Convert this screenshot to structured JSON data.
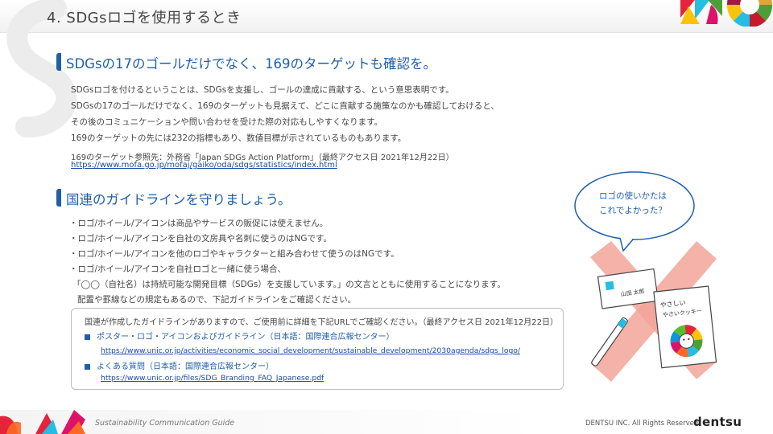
{
  "header": {
    "title": "4. SDGsロゴを使用するとき"
  },
  "section1": {
    "heading": "SDGsの17のゴールだけでなく、169のターゲットも確認を。",
    "lines": [
      "SDGsロゴを付けるということは、SDGsを支援し、ゴールの達成に貢献する、という意思表明です。",
      "SDGsの17のゴールだけでなく、169のターゲットも見据えて、どこに貢献する施策なのかも確認しておけると、",
      "その後のコミュニケーションや問い合わせを受けた際の対応もしやすくなります。",
      "169のターゲットの先には232の指標もあり、数値目標が示されているものもあります。"
    ],
    "reference": "169のターゲット参照先：外務省「Japan SDGs Action Platform」（最終アクセス日 2021年12月22日）",
    "reference_url": "https://www.mofa.go.jp/mofaj/gaiko/oda/sdgs/statistics/index.html"
  },
  "section2": {
    "heading": "国連のガイドラインを守りましょう。",
    "bullets": [
      "・ロゴ/ホイール/アイコンは商品やサービスの販促には使えません。",
      "・ロゴ/ホイール/アイコンを自社の文房具や名刺に使うのはNGです。",
      "・ロゴ/ホイール/アイコンを他のロゴやキャラクターと組み合わせて使うのはNGです。",
      "・ロゴ/ホイール/アイコンを自社ロゴと一緒に使う場合、",
      "「◯◯（自社名）は持続可能な開発目標（SDGs）を支援しています。」の文言とともに使用することになります。",
      "配置や罫線などの規定もあるので、下記ガイドラインをご確認ください。"
    ]
  },
  "guide_box": {
    "intro": "国連が作成したガイドラインがありますので、ご使用前に詳細を下記URLでご確認ください。（最終アクセス日 2021年12月22日）",
    "items": [
      {
        "label": "ポスター・ロゴ・アイコンおよびガイドライン（日本語：国際連合広報センター）",
        "url": "https://www.unic.or.jp/activities/economic_social_development/sustainable_development/2030agenda/sdgs_logo/"
      },
      {
        "label": "よくある質問（日本語：国際連合広報センター）",
        "url": "https://www.unic.or.jp/files/SDG_Branding_FAQ_Japanese.pdf"
      }
    ]
  },
  "bubble": {
    "lines": [
      "ロゴの使いかたは",
      "これでよかった？"
    ]
  },
  "illustration": {
    "card_text": "山田 太郎",
    "box_text_1": "やさしい",
    "box_text_2": "やさいクッキー"
  },
  "footer": {
    "left": "Sustainability Communication Guide",
    "right": "DENTSU INC. All Rights Reserved.",
    "brand": "dentsu"
  },
  "colors": {
    "accent": "#1f5fa8",
    "link": "#1a4aa6",
    "cross": "#f2a49a"
  }
}
